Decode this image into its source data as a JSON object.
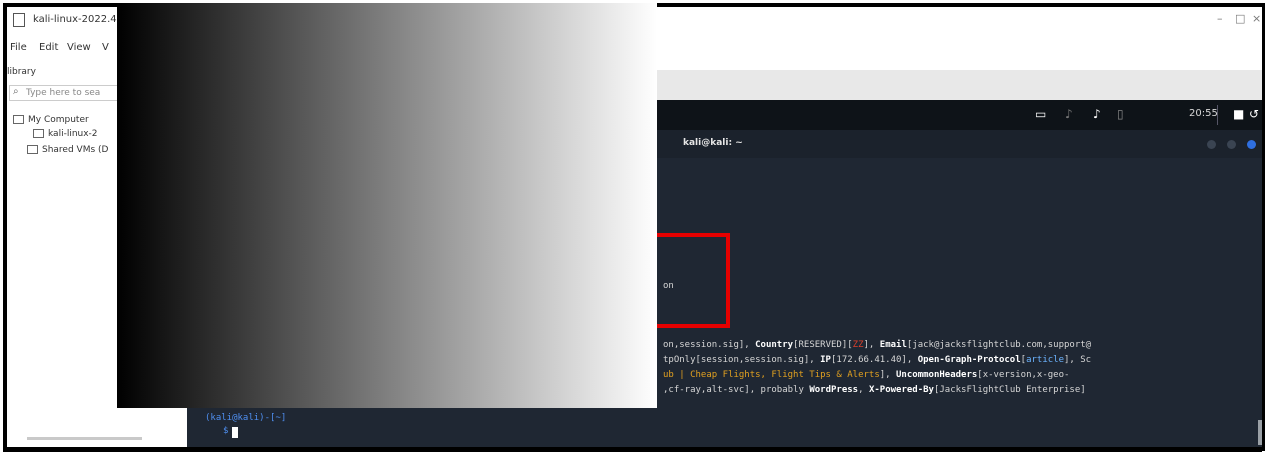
{
  "window": {
    "title": "kali-linux-2022.4-",
    "controls": [
      "–",
      "□",
      "×"
    ]
  },
  "menu": [
    "File",
    "Edit",
    "View",
    "V"
  ],
  "library": {
    "header": "library",
    "search_placeholder": "Type here to sea",
    "items": [
      "My Computer",
      "kali-linux-2",
      "Shared VMs (D"
    ]
  },
  "kali_panel": {
    "time": "20:55"
  },
  "terminal": {
    "title": "kali@kali: ~",
    "partial_text": "on",
    "lines": [
      {
        "pre": "on,session.sig], ",
        "k1": "Country",
        "mid1": "[RESERVED][",
        "red": "ZZ",
        "mid2": "], ",
        "k2": "Email",
        "post": "[jack@jacksflightclub.com,support@"
      },
      {
        "pre": "tpOnly[session,session.sig], ",
        "k1": "IP",
        "mid1": "[172.66.41.40], ",
        "k2": "Open-Graph-Protocol",
        "acc": "article",
        "post": "], Sc"
      },
      {
        "orange": "ub | Cheap Flights, Flight Tips &amp; Alerts",
        "mid1": "], ",
        "k1": "UncommonHeaders",
        "post": "[x-version,x-geo-"
      },
      {
        "pre": ",cf-ray,alt-svc], probably ",
        "k1": "WordPress",
        "mid1": ", ",
        "k2": "X-Powered-By",
        "post": "[JacksFlightClub Enterprise]"
      }
    ],
    "prompt_top": "(kali@kali)-[~]",
    "prompt_bottom": "$"
  }
}
